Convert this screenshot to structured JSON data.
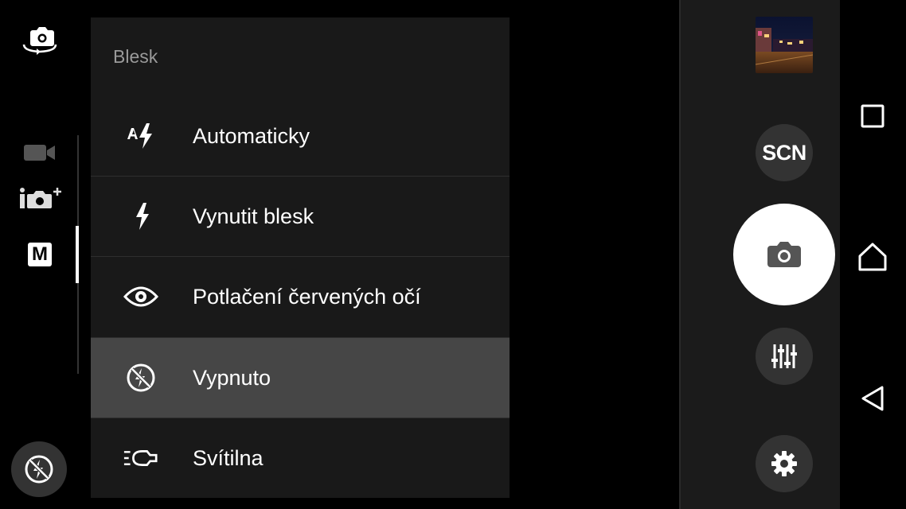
{
  "flash_menu": {
    "title": "Blesk",
    "items": [
      {
        "label": "Automaticky",
        "icon": "flash-auto-icon"
      },
      {
        "label": "Vynutit blesk",
        "icon": "flash-on-icon"
      },
      {
        "label": "Potlačení červených očí",
        "icon": "red-eye-icon"
      },
      {
        "label": "Vypnuto",
        "icon": "flash-off-icon",
        "selected": true
      },
      {
        "label": "Svítilna",
        "icon": "torch-icon"
      }
    ]
  },
  "left_rail": {
    "modes": [
      "video-mode",
      "superior-auto-mode",
      "manual-mode"
    ],
    "manual_label": "M",
    "active_mode": "manual-mode"
  },
  "right_panel": {
    "scene_label": "SCN"
  },
  "colors": {
    "menu_bg": "#191919",
    "selected_bg": "#464646",
    "panel_bg": "#1b1b1b",
    "shutter": "#ffffff"
  }
}
